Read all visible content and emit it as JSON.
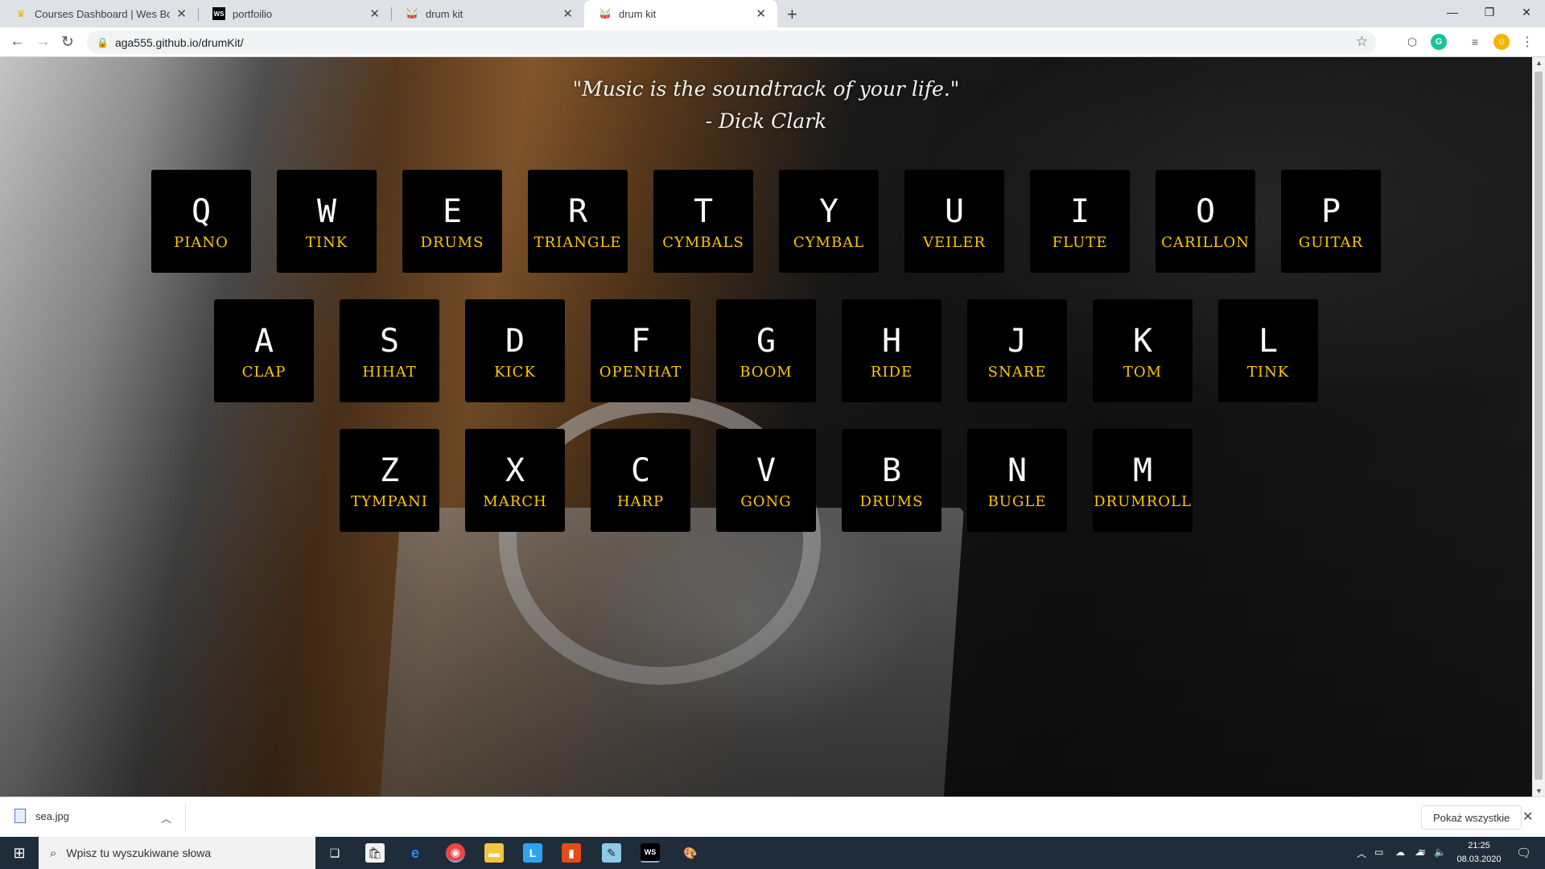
{
  "browser": {
    "tabs": [
      {
        "title": "Courses Dashboard | Wes Bos",
        "favicon": "crown-icon"
      },
      {
        "title": "portfoilio",
        "favicon": "webstorm-icon"
      },
      {
        "title": "drum kit",
        "favicon": "drum-icon"
      },
      {
        "title": "drum kit",
        "favicon": "drum-icon",
        "active": true
      }
    ],
    "new_tab": "+",
    "url": "aga555.github.io/drumKit/",
    "icons": {
      "back": "←",
      "forward": "→",
      "reload": "↻",
      "lock": "🔒",
      "star": "☆",
      "minimize": "—",
      "restore": "❐",
      "close": "✕",
      "tab_close": "✕"
    }
  },
  "page": {
    "quote_line1": "\"Music is the soundtrack of your life.\"",
    "quote_line2": "- Dick Clark",
    "keys": [
      {
        "key": "Q",
        "sound": "PIANO"
      },
      {
        "key": "W",
        "sound": "TINK"
      },
      {
        "key": "E",
        "sound": "DRUMS"
      },
      {
        "key": "R",
        "sound": "TRIANGLE"
      },
      {
        "key": "T",
        "sound": "CYMBALS"
      },
      {
        "key": "Y",
        "sound": "CYMBAL"
      },
      {
        "key": "U",
        "sound": "VEILER"
      },
      {
        "key": "I",
        "sound": "FLUTE"
      },
      {
        "key": "O",
        "sound": "CARILLON"
      },
      {
        "key": "P",
        "sound": "GUITAR"
      },
      {
        "key": "A",
        "sound": "CLAP"
      },
      {
        "key": "S",
        "sound": "HIHAT"
      },
      {
        "key": "D",
        "sound": "KICK"
      },
      {
        "key": "F",
        "sound": "OPENHAT"
      },
      {
        "key": "G",
        "sound": "BOOM"
      },
      {
        "key": "H",
        "sound": "RIDE"
      },
      {
        "key": "J",
        "sound": "SNARE"
      },
      {
        "key": "K",
        "sound": "TOM"
      },
      {
        "key": "L",
        "sound": "TINK"
      },
      {
        "key": "Z",
        "sound": "TYMPANI"
      },
      {
        "key": "X",
        "sound": "MARCH"
      },
      {
        "key": "C",
        "sound": "HARP"
      },
      {
        "key": "V",
        "sound": "GONG"
      },
      {
        "key": "B",
        "sound": "DRUMS"
      },
      {
        "key": "N",
        "sound": "BUGLE"
      },
      {
        "key": "M",
        "sound": "DRUMROLL"
      }
    ],
    "colors": {
      "key_bg": "#000000",
      "key_letter": "#ffffff",
      "sound_label": "#ffc600"
    }
  },
  "downloads": {
    "file_name": "sea.jpg",
    "show_all": "Pokaż wszystkie"
  },
  "taskbar": {
    "search_placeholder": "Wpisz tu wyszukiwane słowa",
    "time": "21:25",
    "date": "08.03.2020",
    "apps": [
      "task-view-icon",
      "store-icon",
      "edge-icon",
      "chrome-icon",
      "file-explorer-icon",
      "lesson-icon",
      "office-icon",
      "notepad-icon",
      "webstorm-icon",
      "paint-icon"
    ]
  }
}
